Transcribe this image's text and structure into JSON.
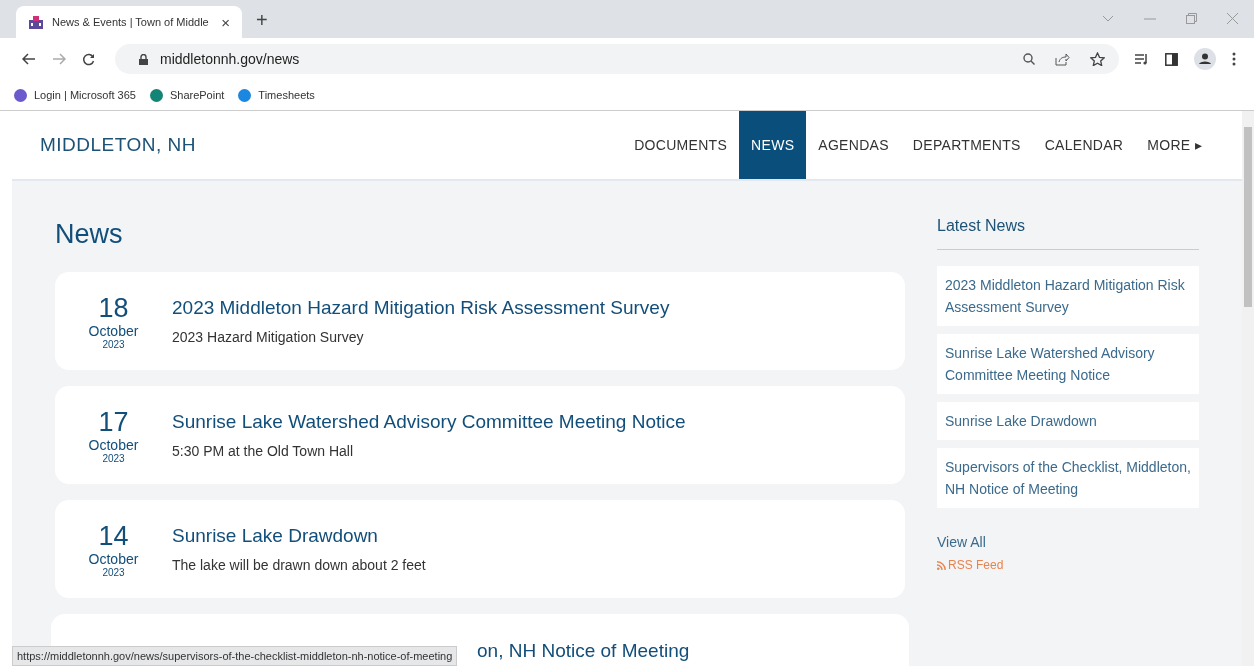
{
  "browser": {
    "tab": {
      "title": "News & Events | Town of Middle",
      "close": "×"
    },
    "new_tab": "+",
    "address": "middletonnh.gov/news",
    "bookmarks": [
      {
        "label": "Login | Microsoft 365",
        "color": "#6a5acd"
      },
      {
        "label": "SharePoint",
        "color": "#138577"
      },
      {
        "label": "Timesheets",
        "color": "#1a88e0"
      }
    ]
  },
  "site": {
    "title": "MIDDLETON, NH",
    "nav": [
      {
        "label": "DOCUMENTS",
        "selected": false
      },
      {
        "label": "NEWS",
        "selected": true
      },
      {
        "label": "AGENDAS",
        "selected": false
      },
      {
        "label": "DEPARTMENTS",
        "selected": false
      },
      {
        "label": "CALENDAR",
        "selected": false
      },
      {
        "label": "MORE ▸",
        "selected": false
      }
    ]
  },
  "page_title": "News",
  "news": [
    {
      "kind": "full",
      "day": "18",
      "month": "October",
      "year": "2023",
      "title": "2023 Middleton Hazard Mitigation Risk Assessment Survey",
      "summary": "2023 Hazard Mitigation Survey"
    },
    {
      "kind": "full",
      "day": "17",
      "month": "October",
      "year": "2023",
      "title": "Sunrise Lake Watershed Advisory Committee Meeting Notice",
      "summary": "5:30 PM at the Old Town Hall"
    },
    {
      "kind": "full",
      "day": "14",
      "month": "October",
      "year": "2023",
      "title": "Sunrise Lake Drawdown",
      "summary": "The lake will be drawn down about 2 feet"
    },
    {
      "kind": "partial",
      "title": "on, NH Notice of Meeting"
    }
  ],
  "sidebar": {
    "title": "Latest News",
    "items": [
      "2023 Middleton Hazard Mitigation Risk Assessment Survey",
      "Sunrise Lake Watershed Advisory Committee Meeting Notice",
      "Sunrise Lake Drawdown",
      "Supervisors of the Checklist, Middleton, NH Notice of Meeting"
    ],
    "view_all": "View All",
    "rss": "RSS Feed"
  },
  "status_url": "https://middletonnh.gov/news/supervisors-of-the-checklist-middleton-nh-notice-of-meeting"
}
